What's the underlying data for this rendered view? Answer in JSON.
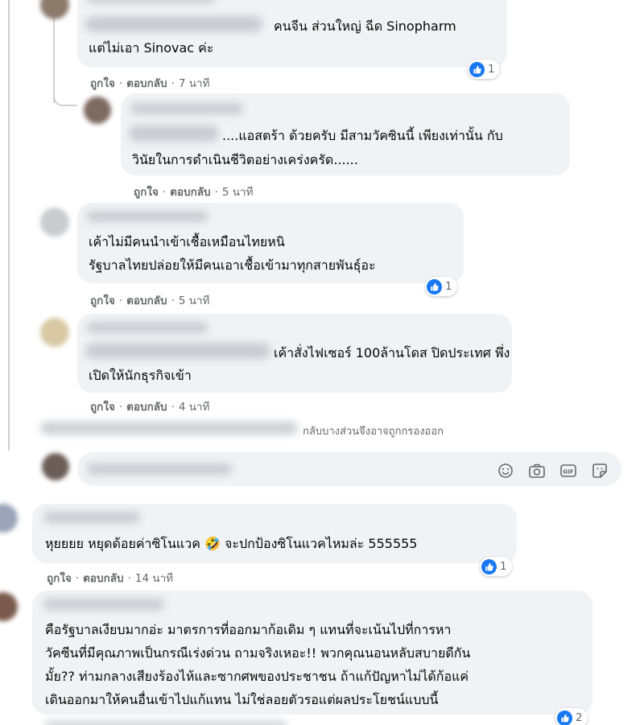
{
  "actions": {
    "like": "ถูกใจ",
    "reply": "ตอบกลับ",
    "separator": "·"
  },
  "comments": [
    {
      "lines": [
        "คนจีน ส่วนใหญ่ ฉีด Sinopharm",
        "แต่ไม่เอา Sinovac ค่ะ"
      ],
      "time": "7 นาที",
      "reactions": "1"
    },
    {
      "lines": [
        "....แอสตร้า ด้วยครับ มีสามวัคซินนี้ เพียงเท่านั้น กับ",
        "วินัยในการดำเนินชีวิตอย่างเคร่งครัด......"
      ],
      "time": "5 นาที"
    },
    {
      "lines": [
        "เค้าไม่มีคนนำเข้าเชื้อเหมือนไทยหนิ",
        "รัฐบาลไทยปล่อยให้มีคนเอาเชื้อเข้ามาทุกสายพันธุ์อะ"
      ],
      "time": "5 นาที",
      "reactions": "1"
    },
    {
      "lines": [
        "เค้าสั่งไฟเซอร์ 100ล้านโดส ปิดประเทศ พึ่ง",
        "เปิดให้นักธุรกิจเข้า"
      ],
      "time": "4 นาที"
    },
    {
      "lines": [
        "หุยยยย หยุดด้อยค่าซิโนแวค 🤣 จะปกป้องซิโนแวคไหมล่ะ 555555"
      ],
      "time": "14 นาที",
      "reactions": "1"
    },
    {
      "lines": [
        "คือรัฐบาลเงียบมากอ่ะ มาตรการที่ออกมาก้อเดิม ๆ แทนที่จะเน้นไปที่การหา",
        "วัคซีนที่มีคุณภาพเป็นกรณีเร่งด่วน ถามจริงเหอะ!! พวกคุณนอนหลับสบายดีกัน",
        "มั้ย?? ท่ามกลางเสียงร้องไห้และซากศพของประชาชน ถ้าแก้ปัญหาไม่ได้ก้อแค่",
        "เดินออกมาให้คนอื่นเข้าไปแก้แทน ไม่ใช่ลอยตัวรอแต่ผลประโยชน์แบบนี้"
      ],
      "reactions": "2"
    }
  ],
  "filter_notice": "กลับบางส่วนจึงอาจถูกกรองออก",
  "composer": {
    "icons": [
      "emoji-icon",
      "camera-icon",
      "gif-icon",
      "sticker-icon"
    ],
    "gif_label": "GIF"
  },
  "colors": {
    "bubble": "#f0f2f5",
    "meta_text": "#65676b",
    "like_blue": "#1877f2"
  }
}
